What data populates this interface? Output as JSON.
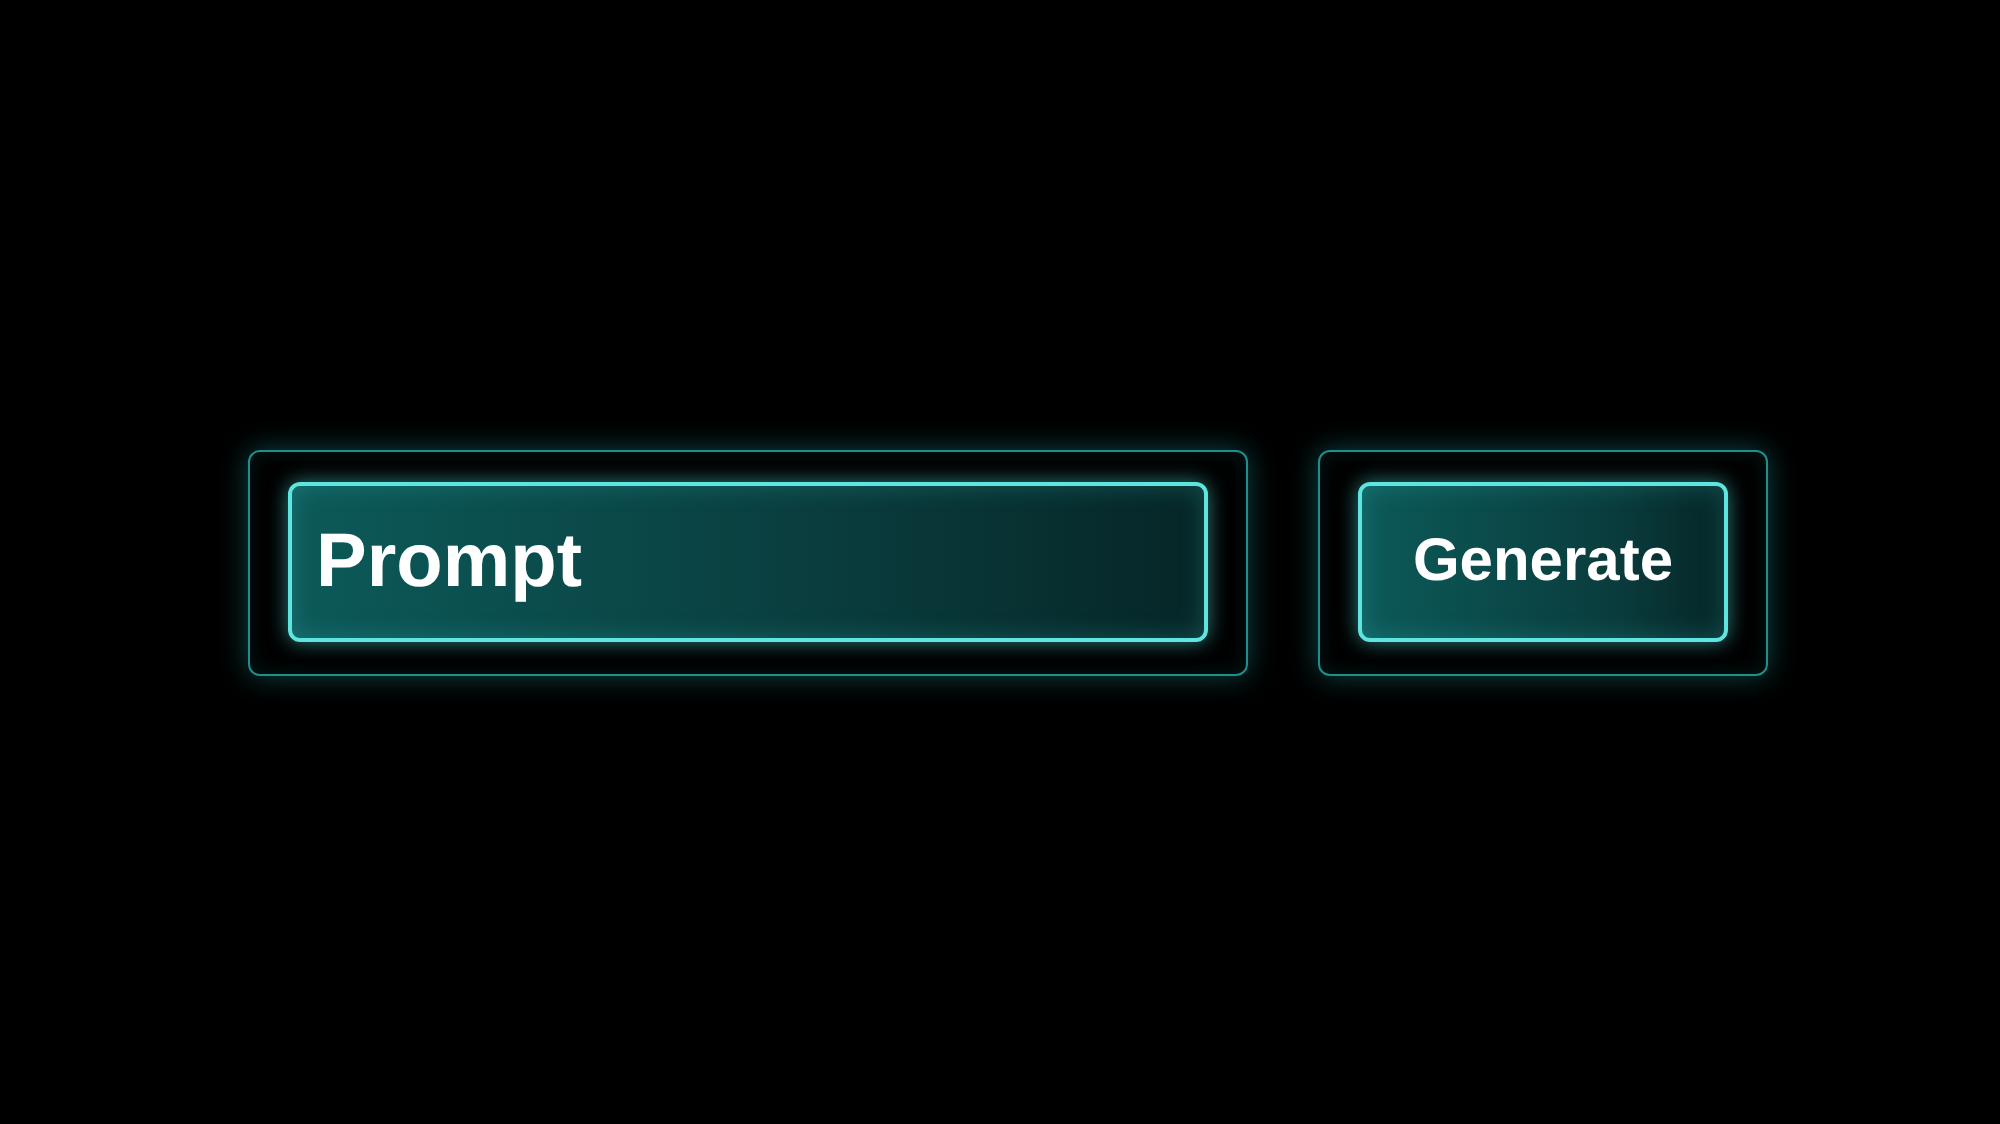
{
  "prompt_field": {
    "placeholder": "Prompt"
  },
  "generate_button": {
    "label": "Generate"
  }
}
